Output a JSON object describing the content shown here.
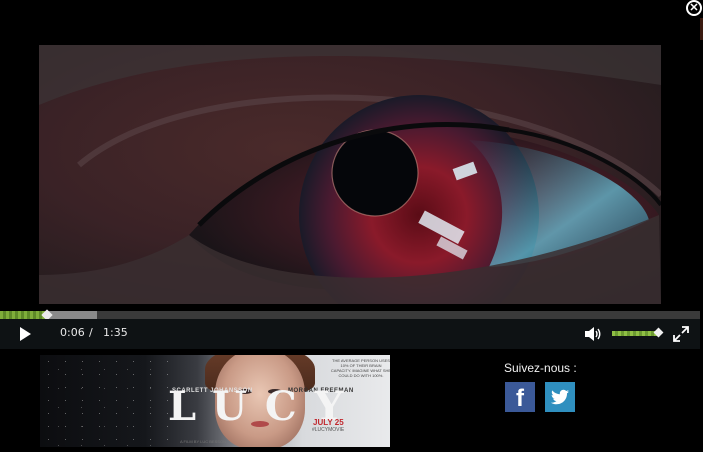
{
  "window": {
    "close_glyph": "✕"
  },
  "player": {
    "current_time": "0:06",
    "separator": "/",
    "duration": "1:35",
    "progress_played_fraction": 0.067,
    "progress_buffered_fraction": 0.139,
    "volume_fraction": 0.97,
    "play_icon": "play-icon",
    "volume_icon": "speaker-icon",
    "fullscreen_icon": "fullscreen-icon",
    "accent_color": "#7fae3a"
  },
  "poster": {
    "title": "LUCY",
    "actor_left": "SCARLETT JOHANSSON",
    "actor_right": "MORGAN FREEMAN",
    "release_date": "JULY 25",
    "hashtag": "#LUCYMOVIE",
    "tagline": "THE AVERAGE PERSON USES 10% OF THEIR BRAIN CAPACITY. IMAGINE WHAT SHE COULD DO WITH 100%.",
    "credit": "A FILM BY LUC BESSON"
  },
  "social": {
    "label": "Suivez-nous :",
    "facebook_glyph": "f",
    "facebook_color": "#3b5998",
    "twitter_color": "#2f8fbf"
  }
}
